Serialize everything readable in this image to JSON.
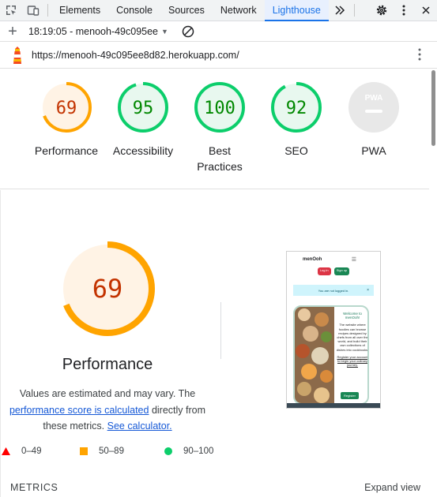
{
  "devtools": {
    "tabs": [
      {
        "label": "Elements"
      },
      {
        "label": "Console"
      },
      {
        "label": "Sources"
      },
      {
        "label": "Network"
      },
      {
        "label": "Lighthouse"
      }
    ],
    "more_tabs_icon": "chevron-double-right-icon",
    "settings_icon": "gear-icon",
    "menu_icon": "vertical-dots-icon",
    "close_icon": "close-icon",
    "active_tab": "Lighthouse"
  },
  "toolbar": {
    "report_selector": "18:19:05 - menooh-49c095ee",
    "add_icon": "plus-icon",
    "clear_icon": "block-icon"
  },
  "urlbar": {
    "url": "https://menooh-49c095ee8d82.herokuapp.com/",
    "logo_icon": "lighthouse-icon"
  },
  "categories": [
    {
      "score": "69",
      "label": "Performance",
      "value": 0.69,
      "status": "average"
    },
    {
      "score": "95",
      "label": "Accessibility",
      "value": 0.95,
      "status": "pass"
    },
    {
      "score": "100",
      "label": "Best Practices",
      "value": 1.0,
      "status": "pass"
    },
    {
      "score": "92",
      "label": "SEO",
      "value": 0.92,
      "status": "pass"
    },
    {
      "score": "",
      "label": "PWA",
      "badge": "PWA",
      "status": "na"
    }
  ],
  "performance": {
    "score": "69",
    "value": 0.69,
    "title": "Performance",
    "desc_1": "Values are estimated and may vary. The",
    "desc_link_1": "performance score is calculated",
    "desc_2": "directly from",
    "desc_3": "these metrics.",
    "desc_link_2": "See calculator."
  },
  "legend": [
    {
      "range": "0–49",
      "shape": "triangle",
      "color": "#ff0000"
    },
    {
      "range": "50–89",
      "shape": "square",
      "color": "#ffa400"
    },
    {
      "range": "90–100",
      "shape": "circle",
      "color": "#0cce6b"
    }
  ],
  "metrics": {
    "label": "METRICS",
    "expand": "Expand view"
  },
  "screenshot": {
    "logo": "menOoh",
    "login": "Log in",
    "signup": "Sign up",
    "alert": "You are not logged in.",
    "welcome": "Welcome to menOoh!",
    "body": "The website where foodies can browse recipes designed by chefs from all over the world, and build their own collections of dishes into cookbooks.",
    "cta_text": "Register your account to begin your culinary journey.",
    "register": "Register"
  },
  "colors": {
    "average_stroke": "#ffa400",
    "average_fill": "#fff3e5",
    "average_text": "#c33300",
    "pass_stroke": "#0cce6b",
    "pass_fill": "#e8f8ef",
    "pass_text": "#008800",
    "na_fill": "#e8e8e8",
    "link": "#1558d6"
  }
}
